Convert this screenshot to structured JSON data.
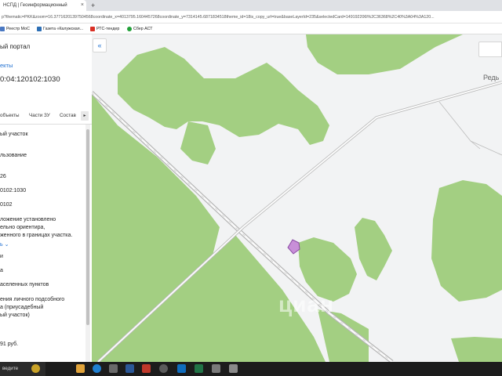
{
  "browser": {
    "tab_title": "НСПД | Геоинформационный",
    "tab_close": "×",
    "new_tab": "+",
    "url": "p?thematic=PKK&zoom=16.37716201397504568coordinate_x=4013795.1604457268coordinate_y=7314145.6871834518theme_id=18is_copy_url=true&baseLayerId=235&selectedCard=149192206l%2C36368%2C40%3A04%3A120..."
  },
  "bookmarks": [
    {
      "label": "Реестр МоС",
      "color": "#4a78c2"
    },
    {
      "label": "Газета «Калужская...",
      "color": "#2d6fb5"
    },
    {
      "label": "РТС-тендер",
      "color": "#d93025"
    },
    {
      "label": "Сбер АСТ",
      "color": "#21a038"
    }
  ],
  "sidebar": {
    "portal": "ый портал",
    "objects_link": "екты",
    "cadastral_number": "0:04:120102:1030",
    "tabs": [
      "объекты",
      "Части ЗУ",
      "Состав"
    ],
    "tab_arrow": "▸",
    "lines": [
      {
        "text": "ый участок",
        "link": false
      },
      {
        "text": "льзование",
        "link": false
      },
      {
        "text": "26",
        "link": false
      },
      {
        "text": "0102:1030",
        "link": false
      },
      {
        "text": "0102",
        "link": false
      },
      {
        "text": "ложение установлено",
        "link": false
      },
      {
        "text": "ельно ориентира,",
        "link": false
      },
      {
        "text": "женного в границах участка.",
        "link": false
      },
      {
        "text": "ь ⌄",
        "link": true
      },
      {
        "text": "и",
        "link": false
      },
      {
        "text": "а",
        "link": false
      },
      {
        "text": "аселенных пунктов",
        "link": false
      },
      {
        "text": "ения личного подсобного",
        "link": false
      },
      {
        "text": "а (приусадебный",
        "link": false
      },
      {
        "text": "ый участок)",
        "link": false
      },
      {
        "text": "91 руб.",
        "link": false
      }
    ]
  },
  "map": {
    "collapse_icon": "«",
    "place_label": "Редь",
    "watermark": "циан",
    "land_color": "#a3cf82",
    "road_color": "#b5b5b5",
    "parcel_color": "#c88fd8"
  },
  "taskbar": {
    "search": "ведите"
  }
}
